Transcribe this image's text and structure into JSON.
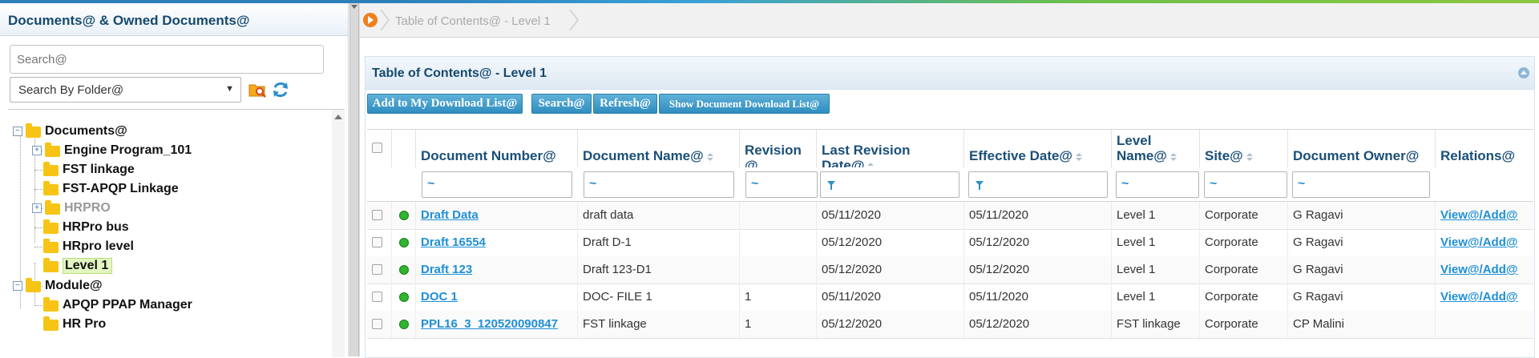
{
  "left_panel": {
    "title": "Documents@ & Owned Documents@",
    "search_placeholder": "Search@",
    "folder_select_value": "Search By Folder@",
    "tree": [
      {
        "label": "Documents@",
        "expander": "minus",
        "level": 0,
        "grey": false,
        "selected": false
      },
      {
        "label": "Engine Program_101",
        "expander": "plus",
        "level": 1,
        "grey": false,
        "selected": false
      },
      {
        "label": "FST linkage",
        "expander": "",
        "level": 1,
        "grey": false,
        "selected": false
      },
      {
        "label": "FST-APQP Linkage",
        "expander": "",
        "level": 1,
        "grey": false,
        "selected": false
      },
      {
        "label": "HRPRO",
        "expander": "plus",
        "level": 1,
        "grey": true,
        "selected": false
      },
      {
        "label": "HRPro bus",
        "expander": "",
        "level": 1,
        "grey": false,
        "selected": false
      },
      {
        "label": "HRpro level",
        "expander": "",
        "level": 1,
        "grey": false,
        "selected": false
      },
      {
        "label": "Level 1",
        "expander": "",
        "level": 1,
        "grey": false,
        "selected": true
      },
      {
        "label": "Module@",
        "expander": "minus",
        "level": 0,
        "grey": false,
        "selected": false
      },
      {
        "label": "APQP PPAP Manager",
        "expander": "",
        "level": 1,
        "grey": false,
        "selected": false
      },
      {
        "label": "HR Pro",
        "expander": "",
        "level": 1,
        "grey": false,
        "selected": false
      }
    ]
  },
  "breadcrumb": {
    "current": "Table of Contents@ - Level 1"
  },
  "panel": {
    "title": "Table of Contents@ - Level 1",
    "buttons": {
      "add_download": "Add to My Download List@",
      "search": "Search@",
      "refresh": "Refresh@",
      "show_download": "Show Document Download List@"
    }
  },
  "table": {
    "headers": {
      "doc_number": "Document Number@",
      "doc_name": "Document Name@",
      "revision": "Revision @",
      "last_revision_date": "Last Revision Date@",
      "effective_date": "Effective Date@",
      "level_name": "Level Name@",
      "site": "Site@",
      "owner": "Document Owner@",
      "relations": "Relations@"
    },
    "filter_symbol": "~",
    "rows": [
      {
        "doc_number": "Draft Data ",
        "doc_name": "draft data",
        "revision": "",
        "last_revision_date": "05/11/2020",
        "effective_date": "05/11/2020",
        "level_name": "Level 1",
        "site": "Corporate",
        "owner": "G Ragavi",
        "relations": "View@/Add@"
      },
      {
        "doc_number": "Draft 16554",
        "doc_name": "Draft D-1",
        "revision": "",
        "last_revision_date": "05/12/2020",
        "effective_date": "05/12/2020",
        "level_name": "Level 1",
        "site": "Corporate",
        "owner": "G Ragavi",
        "relations": "View@/Add@"
      },
      {
        "doc_number": "Draft 123",
        "doc_name": "Draft 123-D1",
        "revision": "",
        "last_revision_date": "05/12/2020",
        "effective_date": "05/12/2020",
        "level_name": "Level 1",
        "site": "Corporate",
        "owner": "G Ragavi",
        "relations": "View@/Add@"
      },
      {
        "doc_number": "DOC 1",
        "doc_name": "DOC- FILE 1",
        "revision": "1",
        "last_revision_date": "05/11/2020",
        "effective_date": "05/11/2020",
        "level_name": "Level 1",
        "site": "Corporate",
        "owner": "G Ragavi",
        "relations": "View@/Add@"
      },
      {
        "doc_number": "PPL16_3_120520090847",
        "doc_name": "FST linkage",
        "revision": "1",
        "last_revision_date": "05/12/2020",
        "effective_date": "05/12/2020",
        "level_name": "FST linkage",
        "site": "Corporate",
        "owner": "CP Malini",
        "relations": ""
      }
    ]
  },
  "colors": {
    "accent": "#2f8dbf",
    "title": "#15496e",
    "link": "#1f8fd6",
    "status_dot": "#2fb52f"
  }
}
